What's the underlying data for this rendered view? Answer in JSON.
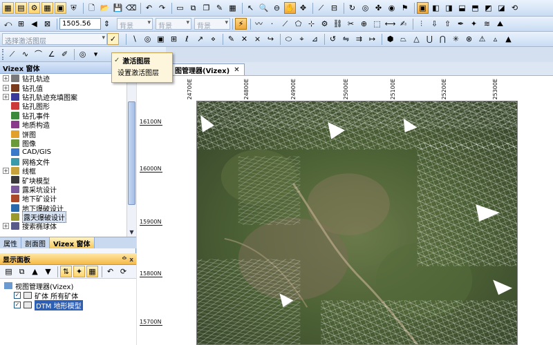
{
  "toolbar": {
    "value_field": "1505.56",
    "combo_1": "背景",
    "combo_2": "背景",
    "combo_3": "背景",
    "layer_combo": "选择激活图层"
  },
  "layer_popup": {
    "title": "激活图层",
    "subtitle": "设置激活图层"
  },
  "left_panel": {
    "title": "Vizex 窗体",
    "tree": [
      {
        "label": "钻孔轨迹",
        "expand": "+",
        "icon_color": "#7a7a7a"
      },
      {
        "label": "钻孔值",
        "expand": "+",
        "icon_color": "#7a3c1c"
      },
      {
        "label": "钻孔轨迹充填图案",
        "expand": "+",
        "icon_color": "#3a3a9a"
      },
      {
        "label": "钻孔图形",
        "expand": "",
        "icon_color": "#cc3a3a"
      },
      {
        "label": "钻孔事件",
        "expand": "",
        "icon_color": "#3a8a3a"
      },
      {
        "label": "地质构造",
        "expand": "",
        "icon_color": "#8a3a8a"
      },
      {
        "label": "饼图",
        "expand": "",
        "icon_color": "#e2a12a"
      },
      {
        "label": "图像",
        "expand": "",
        "icon_color": "#6a9a3a"
      },
      {
        "label": "CAD/GIS",
        "expand": "",
        "icon_color": "#3a7ac8"
      },
      {
        "label": "网格文件",
        "expand": "",
        "icon_color": "#3a9aaa"
      },
      {
        "label": "线框",
        "expand": "+",
        "icon_color": "#c8a23a"
      },
      {
        "label": "矿块模型",
        "expand": "",
        "icon_color": "#3a3a3a"
      },
      {
        "label": "露采坑设计",
        "expand": "",
        "icon_color": "#7a5a9a"
      },
      {
        "label": "地下矿设计",
        "expand": "",
        "icon_color": "#aa4a2a"
      },
      {
        "label": "地下爆破设计",
        "expand": "",
        "icon_color": "#2a6aaa"
      },
      {
        "label": "露天爆破设计",
        "expand": "",
        "icon_color": "#9a9a2a",
        "selected": true
      },
      {
        "label": "搜索椭球体",
        "expand": "+",
        "icon_color": "#5a5a8a"
      }
    ],
    "tabs": [
      "属性",
      "剖面图",
      "Vizex 窗体"
    ]
  },
  "display_panel": {
    "title": "显示面板",
    "pin": "ᅌ x",
    "items": [
      {
        "label": "视图管理器(Vizex)",
        "indent": 0,
        "checked": false
      },
      {
        "label": "矿体 所有矿体",
        "indent": 1,
        "checked": true
      },
      {
        "label": "DTM 地形模型",
        "indent": 1,
        "checked": true,
        "selected": true
      }
    ]
  },
  "viewer": {
    "tab_label": "图管理器(Vizex)",
    "tab_close": "✕",
    "x_ticks": [
      "24700E",
      "24800E",
      "24900E",
      "25000E",
      "25100E",
      "25200E",
      "25300E"
    ],
    "y_ticks": [
      "16100N",
      "16000N",
      "15900N",
      "15800N",
      "15700N"
    ]
  },
  "icons": {
    "accent": "#f5c85a",
    "selection": "#2d5fb5"
  }
}
